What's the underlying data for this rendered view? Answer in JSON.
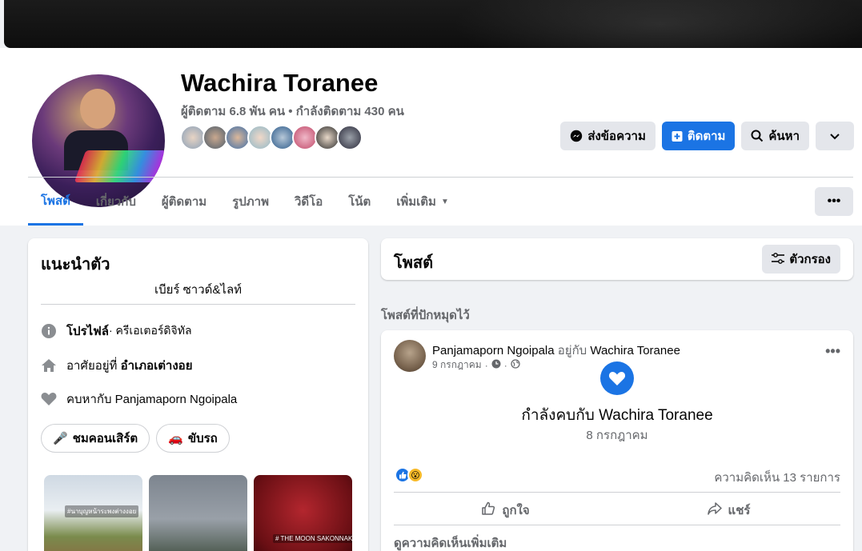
{
  "profile": {
    "name": "Wachira Toranee",
    "followers_text": "ผู้ติดตาม 6.8 พัน คน • กำลังติดตาม 430 คน"
  },
  "actions": {
    "message_label": "ส่งข้อความ",
    "follow_label": "ติดตาม",
    "search_label": "ค้นหา"
  },
  "tabs": [
    {
      "label": "โพสต์"
    },
    {
      "label": "เกี่ยวกับ"
    },
    {
      "label": "ผู้ติดตาม"
    },
    {
      "label": "รูปภาพ"
    },
    {
      "label": "วิดีโอ"
    },
    {
      "label": "โน้ต"
    },
    {
      "label": "เพิ่มเติม"
    }
  ],
  "intro": {
    "title": "แนะนำตัว",
    "bio": "เบียร์ ซาวด์&ไลท์",
    "profile_label": "โปรไฟล์",
    "profile_value": " · ครีเอเตอร์ดิจิทัล",
    "lives_prefix": "อาศัยอยู่ที่ ",
    "lives_value": "อำเภอเต่างอย",
    "relationship_prefix": "คบหากับ ",
    "relationship_value": "Panjamaporn Ngoipala",
    "chips": [
      {
        "emoji": "🎤",
        "label": "ชมคอนเสิร์ต"
      },
      {
        "emoji": "🚗",
        "label": "ขับรถ"
      }
    ],
    "photo1_caption": "#นาบุญหน้าระพงต่างงอย",
    "photo3_caption": "# THE MOON SAKONNAKHON"
  },
  "posts": {
    "title": "โพสต์",
    "filter_label": "ตัวกรอง",
    "pinned_label": "โพสต์ที่ปักหมุดไว้"
  },
  "post": {
    "author": "Panjamaporn Ngoipala",
    "with_text": " อยู่กับ ",
    "with_name": "Wachira Toranee",
    "date": "9 กรกฎาคม",
    "relationship_title": "กำลังคบกับ Wachira Toranee",
    "relationship_date": "8 กรกฎาคม",
    "comments_count": "ความคิดเห็น 13 รายการ",
    "like_label": "ถูกใจ",
    "share_label": "แชร์",
    "more_comments": "ดูความคิดเห็นเพิ่มเติม"
  },
  "colors": {
    "accent": "#1b74e4",
    "secondary_text": "#65676b",
    "button_bg": "#e4e6eb"
  }
}
